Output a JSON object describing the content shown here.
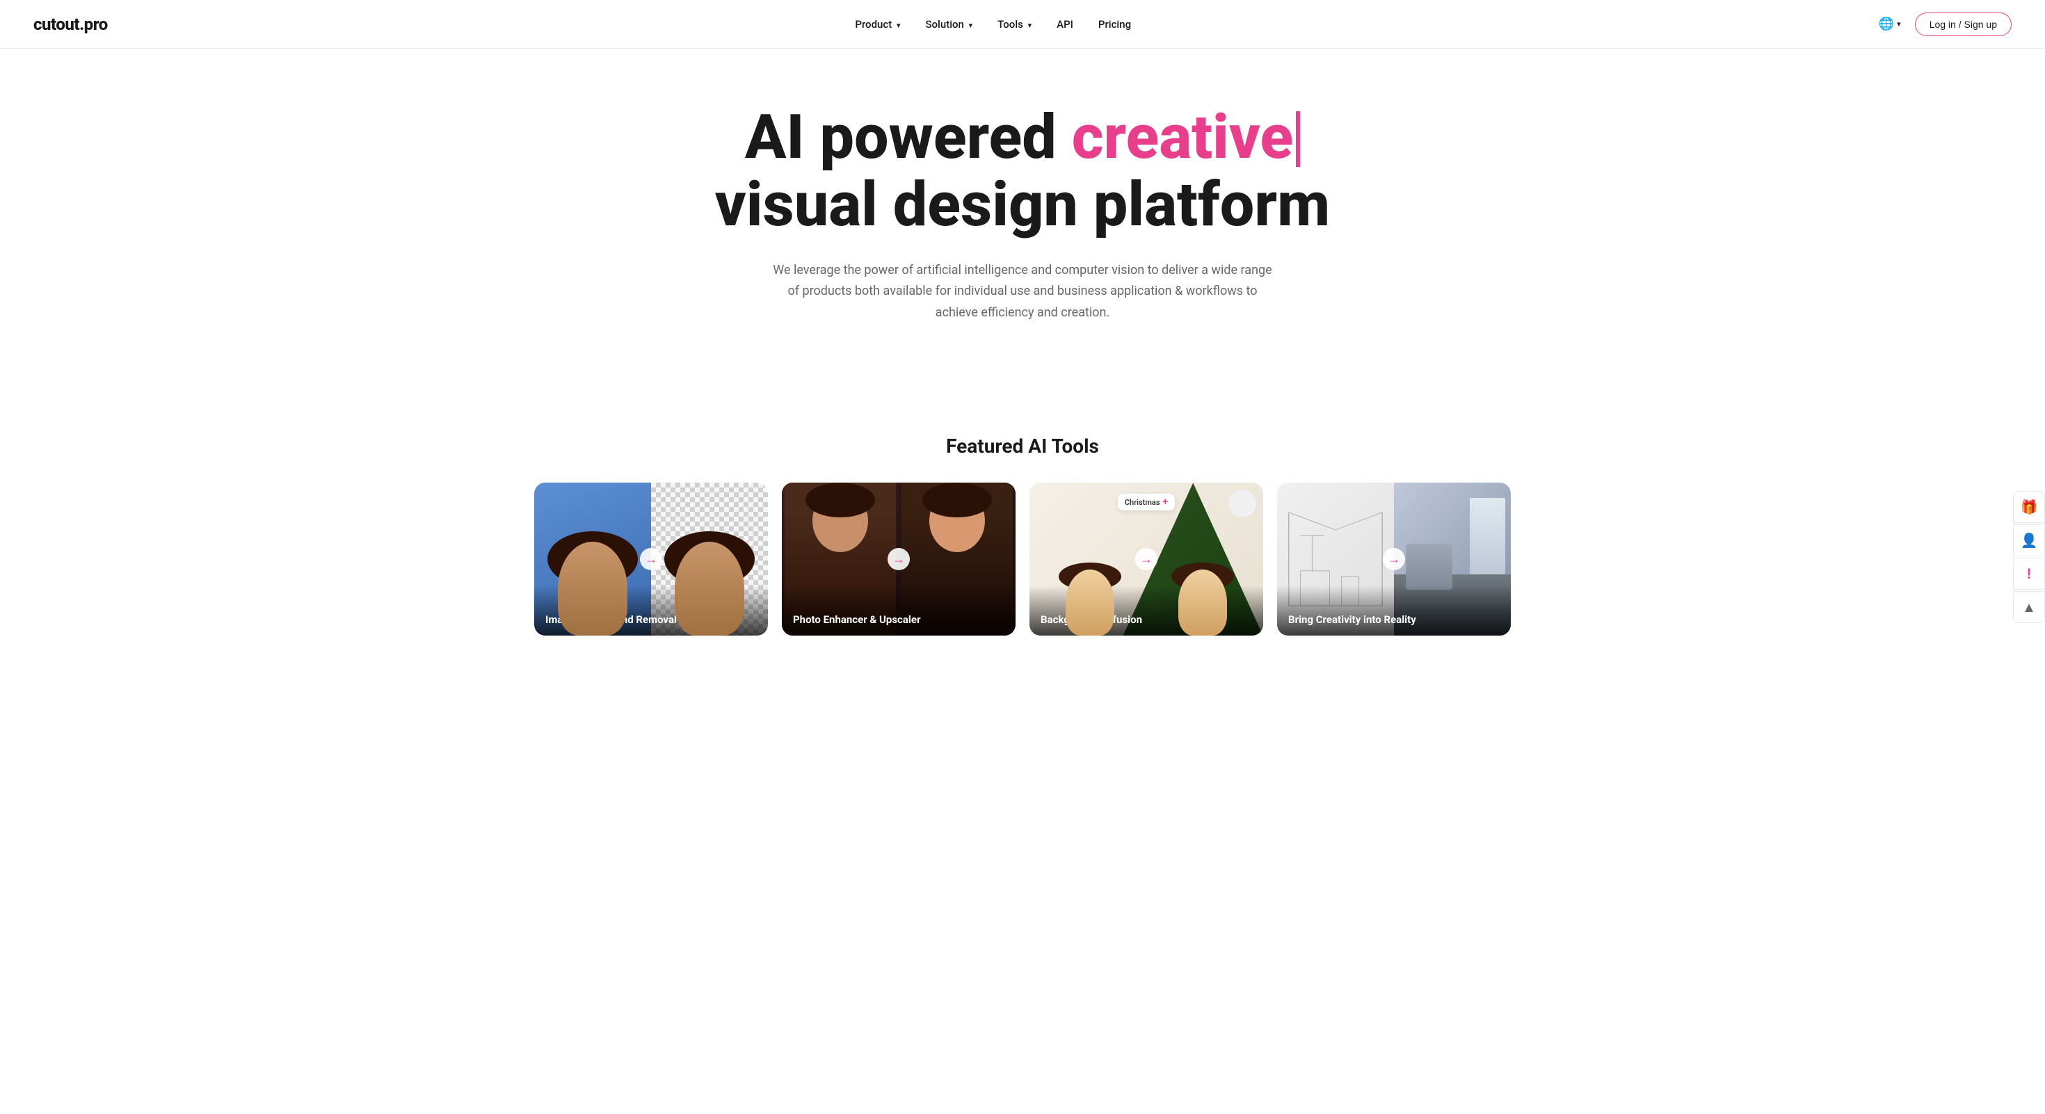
{
  "brand": {
    "name": "cutout.pro"
  },
  "nav": {
    "links": [
      {
        "label": "Product",
        "hasDropdown": true
      },
      {
        "label": "Solution",
        "hasDropdown": true
      },
      {
        "label": "Tools",
        "hasDropdown": true
      },
      {
        "label": "API",
        "hasDropdown": false
      },
      {
        "label": "Pricing",
        "hasDropdown": false
      }
    ],
    "language": "🌐",
    "login_label": "Log in / Sign up"
  },
  "hero": {
    "title_part1": "AI powered ",
    "title_highlight": "creative",
    "title_part2": " visual design platform",
    "subtitle": "We leverage the power of artificial intelligence and computer vision to deliver a wide range of products both available for individual use and business application & workflows to achieve efficiency and creation."
  },
  "featured": {
    "section_title": "Featured AI Tools",
    "tools": [
      {
        "label": "Image Background Removal",
        "id": "bg-removal"
      },
      {
        "label": "Photo Enhancer & Upscaler",
        "id": "photo-enhancer"
      },
      {
        "label": "Background Diffusion",
        "id": "bg-diffusion",
        "badge": "Christmas",
        "badge_icon": "+"
      },
      {
        "label": "Bring Creativity into Reality",
        "id": "creativity"
      }
    ]
  },
  "side_panel": {
    "buttons": [
      {
        "icon": "🎁",
        "label": "gift-icon"
      },
      {
        "icon": "👤",
        "label": "user-icon"
      },
      {
        "icon": "❗",
        "label": "alert-icon"
      },
      {
        "icon": "⬆",
        "label": "upload-icon"
      }
    ]
  }
}
